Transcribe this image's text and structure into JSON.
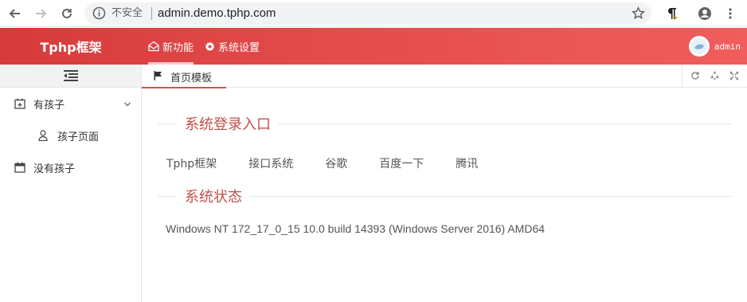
{
  "browser": {
    "insecure_label": "不安全",
    "url": "admin.demo.tphp.com"
  },
  "header": {
    "brand": "Tphp框架",
    "nav": [
      {
        "label": "新功能",
        "icon": "envelope-open-icon"
      },
      {
        "label": "系统设置",
        "icon": "gear-icon"
      }
    ],
    "user": "admin"
  },
  "sidebar": {
    "items": [
      {
        "label": "有孩子",
        "icon": "calendar-plus-icon",
        "expanded": true,
        "children": [
          {
            "label": "孩子页面",
            "icon": "user-icon"
          }
        ]
      },
      {
        "label": "没有孩子",
        "icon": "calendar-icon"
      }
    ]
  },
  "tabs": [
    {
      "label": "首页模板",
      "icon": "flag-icon",
      "active": true
    }
  ],
  "main": {
    "login_section_title": "系统登录入口",
    "links": [
      "Tphp框架",
      "接口系统",
      "谷歌",
      "百度一下",
      "腾讯"
    ],
    "status_section_title": "系统状态",
    "system_info": "Windows NT 172_17_0_15 10.0 build 14393 (Windows Server 2016) AMD64"
  },
  "colors": {
    "accent": "#e24a4a",
    "section_title": "#c0504d"
  }
}
